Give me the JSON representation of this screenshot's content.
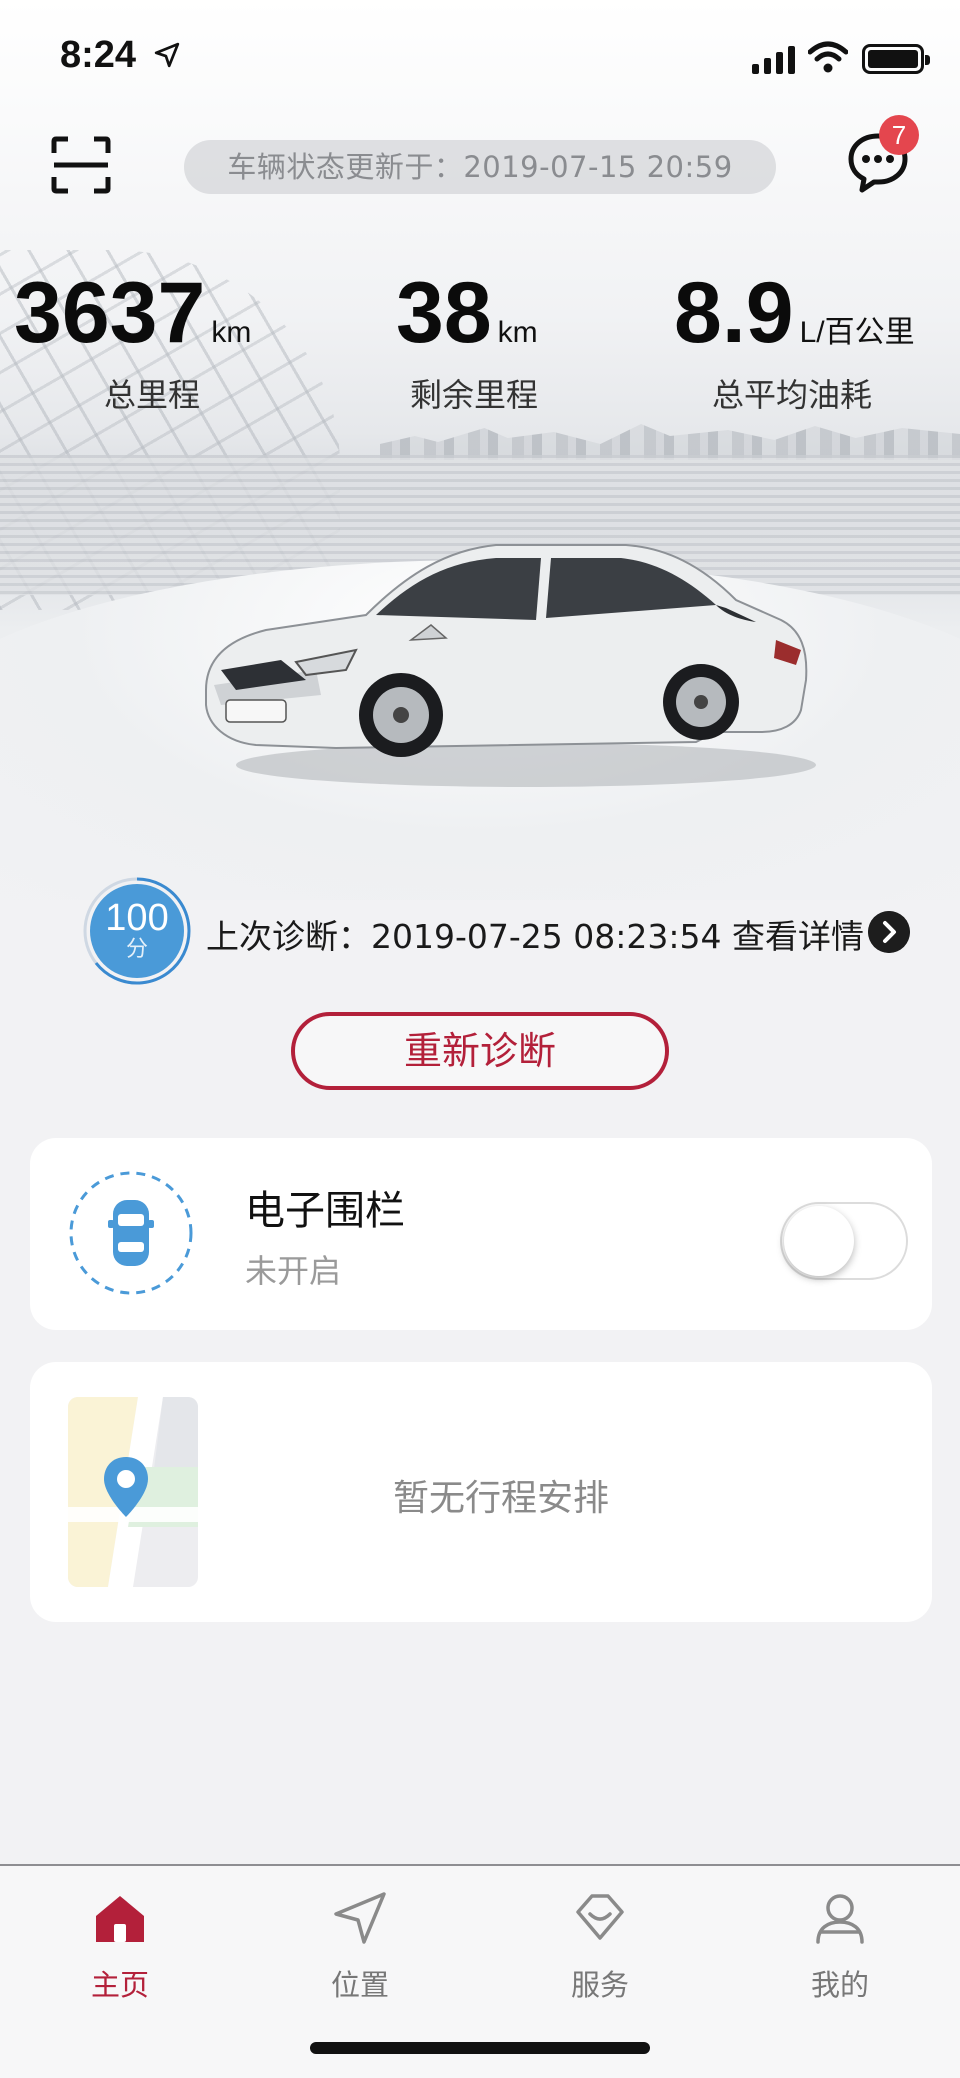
{
  "status_bar": {
    "time": "8:24"
  },
  "header": {
    "update_text": "车辆状态更新于：2019-07-15 20:59",
    "message_badge": "7"
  },
  "stats": [
    {
      "value": "3637",
      "unit": "km",
      "label": "总里程"
    },
    {
      "value": "38",
      "unit": "km",
      "label": "剩余里程"
    },
    {
      "value": "8.9",
      "unit": "L/百公里",
      "label": "总平均油耗"
    }
  ],
  "diagnosis": {
    "score": "100",
    "score_unit": "分",
    "last_text": "上次诊断：2019-07-25 08:23:54 查看详情",
    "rediagnose_label": "重新诊断"
  },
  "fence": {
    "title": "电子围栏",
    "status": "未开启",
    "enabled": false
  },
  "trip": {
    "empty_text": "暂无行程安排"
  },
  "tabs": [
    {
      "label": "主页",
      "icon": "home-icon",
      "active": true
    },
    {
      "label": "位置",
      "icon": "location-arrow-icon",
      "active": false
    },
    {
      "label": "服务",
      "icon": "service-icon",
      "active": false
    },
    {
      "label": "我的",
      "icon": "profile-icon",
      "active": false
    }
  ],
  "colors": {
    "brand": "#b3203a",
    "badge": "#e4464e",
    "score": "#4a9ad8"
  }
}
